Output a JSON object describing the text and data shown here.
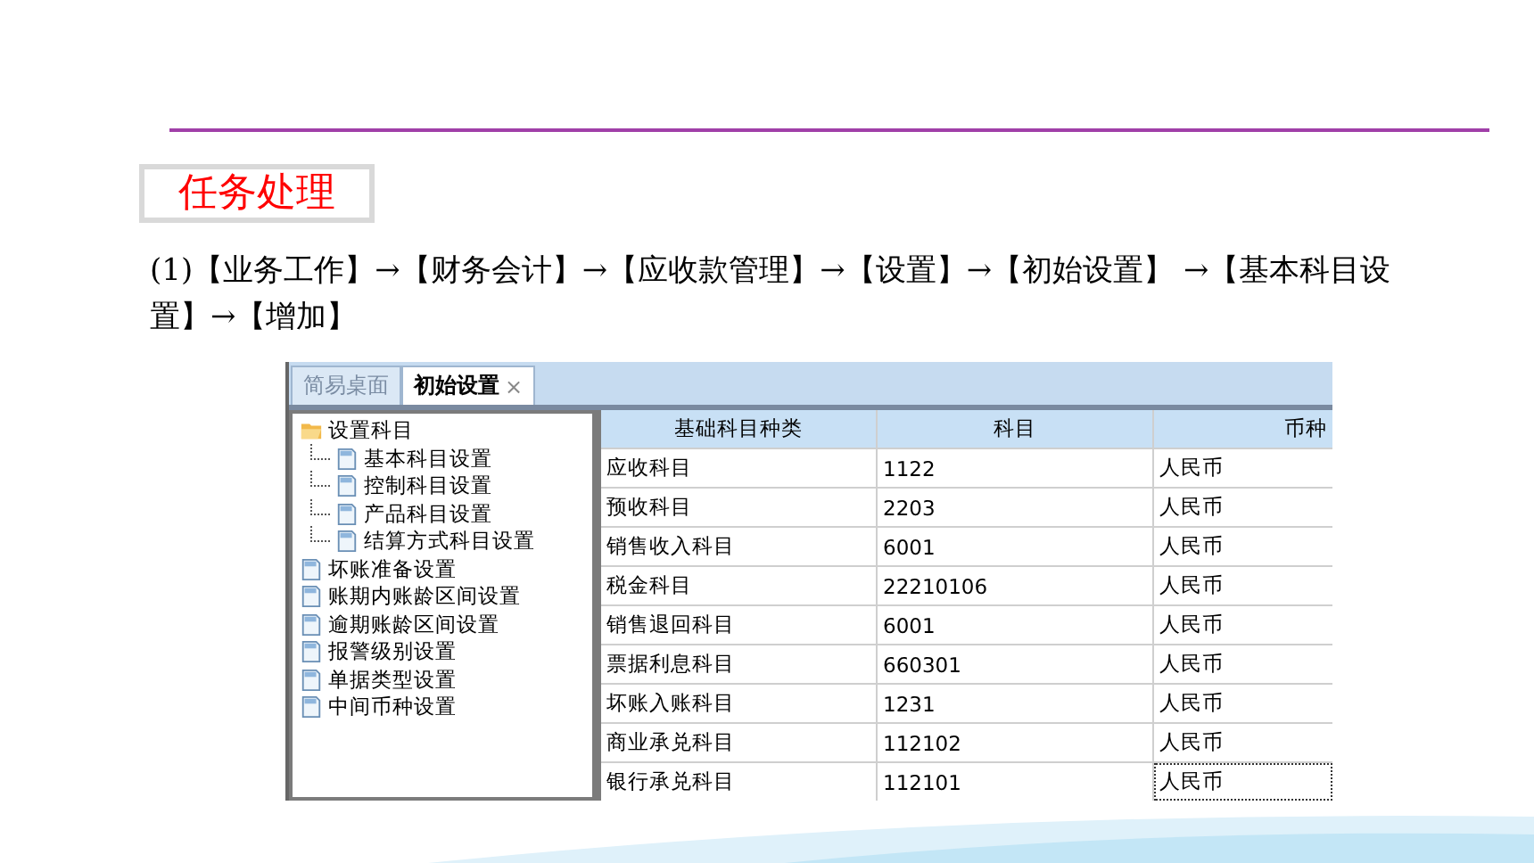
{
  "slide": {
    "heading": "任务处理",
    "instruction": "(1)【业务工作】→【财务会计】→【应收款管理】→【设置】→【初始设置】 →【基本科目设置】→【增加】"
  },
  "app": {
    "tabs": [
      {
        "label": "简易桌面",
        "selected": false
      },
      {
        "label": "初始设置",
        "selected": true,
        "close": "×"
      }
    ],
    "tree": [
      {
        "label": "设置科目",
        "kind": "folder",
        "children": [
          {
            "label": "基本科目设置",
            "kind": "page"
          },
          {
            "label": "控制科目设置",
            "kind": "page"
          },
          {
            "label": "产品科目设置",
            "kind": "page"
          },
          {
            "label": "结算方式科目设置",
            "kind": "page"
          }
        ]
      },
      {
        "label": "坏账准备设置",
        "kind": "page"
      },
      {
        "label": "账期内账龄区间设置",
        "kind": "page"
      },
      {
        "label": "逾期账龄区间设置",
        "kind": "page"
      },
      {
        "label": "报警级别设置",
        "kind": "page"
      },
      {
        "label": "单据类型设置",
        "kind": "page"
      },
      {
        "label": "中间币种设置",
        "kind": "page"
      }
    ],
    "table": {
      "columns": [
        "基础科目种类",
        "科目",
        "币种"
      ],
      "rows": [
        {
          "cells": [
            "应收科目",
            "1122",
            "人民币"
          ],
          "focused": false
        },
        {
          "cells": [
            "预收科目",
            "2203",
            "人民币"
          ],
          "focused": false
        },
        {
          "cells": [
            "销售收入科目",
            "6001",
            "人民币"
          ],
          "focused": false
        },
        {
          "cells": [
            "税金科目",
            "22210106",
            "人民币"
          ],
          "focused": false
        },
        {
          "cells": [
            "销售退回科目",
            "6001",
            "人民币"
          ],
          "focused": false
        },
        {
          "cells": [
            "票据利息科目",
            "660301",
            "人民币"
          ],
          "focused": false
        },
        {
          "cells": [
            "坏账入账科目",
            "1231",
            "人民币"
          ],
          "focused": false
        },
        {
          "cells": [
            "商业承兑科目",
            "112102",
            "人民币"
          ],
          "focused": false
        },
        {
          "cells": [
            "银行承兑科目",
            "112101",
            "人民币"
          ],
          "focused": true
        }
      ]
    }
  }
}
